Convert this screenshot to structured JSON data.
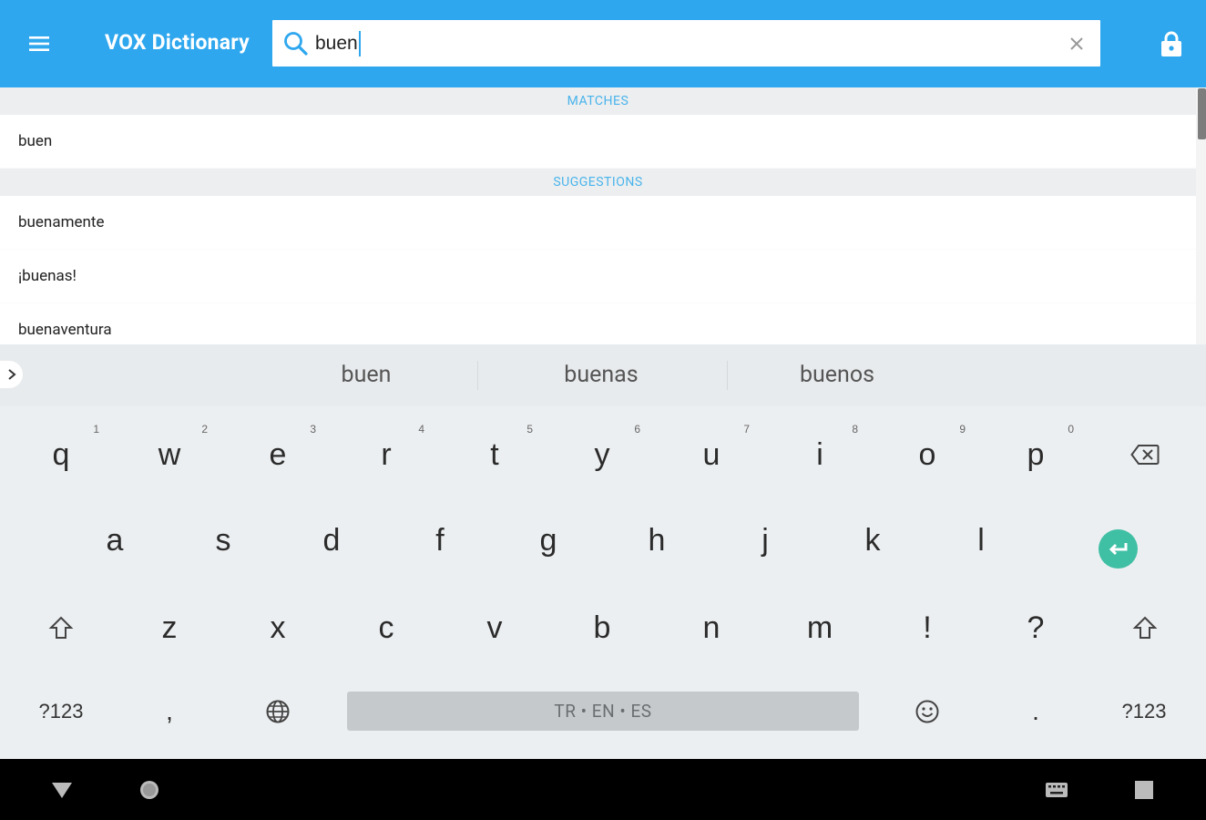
{
  "header": {
    "app_title": "VOX Dictionary",
    "search_value": "buen",
    "accent_color": "#2ea7ee",
    "icons": {
      "menu": "menu-icon",
      "search": "search-icon",
      "clear": "close-icon",
      "lock": "lock-icon"
    }
  },
  "results": {
    "matches_header": "MATCHES",
    "matches": [
      {
        "label": "buen"
      }
    ],
    "suggestions_header": "SUGGESTIONS",
    "suggestions": [
      {
        "label": "buenamente"
      },
      {
        "label": "¡buenas!"
      },
      {
        "label": "buenaventura"
      }
    ]
  },
  "keyboard": {
    "suggestion_strip": [
      "buen",
      "buenas",
      "buenos"
    ],
    "row1": [
      {
        "key": "q",
        "hint": "1"
      },
      {
        "key": "w",
        "hint": "2"
      },
      {
        "key": "e",
        "hint": "3"
      },
      {
        "key": "r",
        "hint": "4"
      },
      {
        "key": "t",
        "hint": "5"
      },
      {
        "key": "y",
        "hint": "6"
      },
      {
        "key": "u",
        "hint": "7"
      },
      {
        "key": "i",
        "hint": "8"
      },
      {
        "key": "o",
        "hint": "9"
      },
      {
        "key": "p",
        "hint": "0"
      }
    ],
    "row2": [
      "a",
      "s",
      "d",
      "f",
      "g",
      "h",
      "j",
      "k",
      "l"
    ],
    "row3": [
      "z",
      "x",
      "c",
      "v",
      "b",
      "n",
      "m",
      "!",
      "?"
    ],
    "symbols_label": "?123",
    "comma": ",",
    "period": ".",
    "space_label": "TR • EN • ES",
    "enter_color": "#3fbfa4"
  },
  "navbar": {
    "icons": [
      "back-icon",
      "home-icon",
      "keyboard-switch-icon",
      "recents-icon"
    ]
  }
}
